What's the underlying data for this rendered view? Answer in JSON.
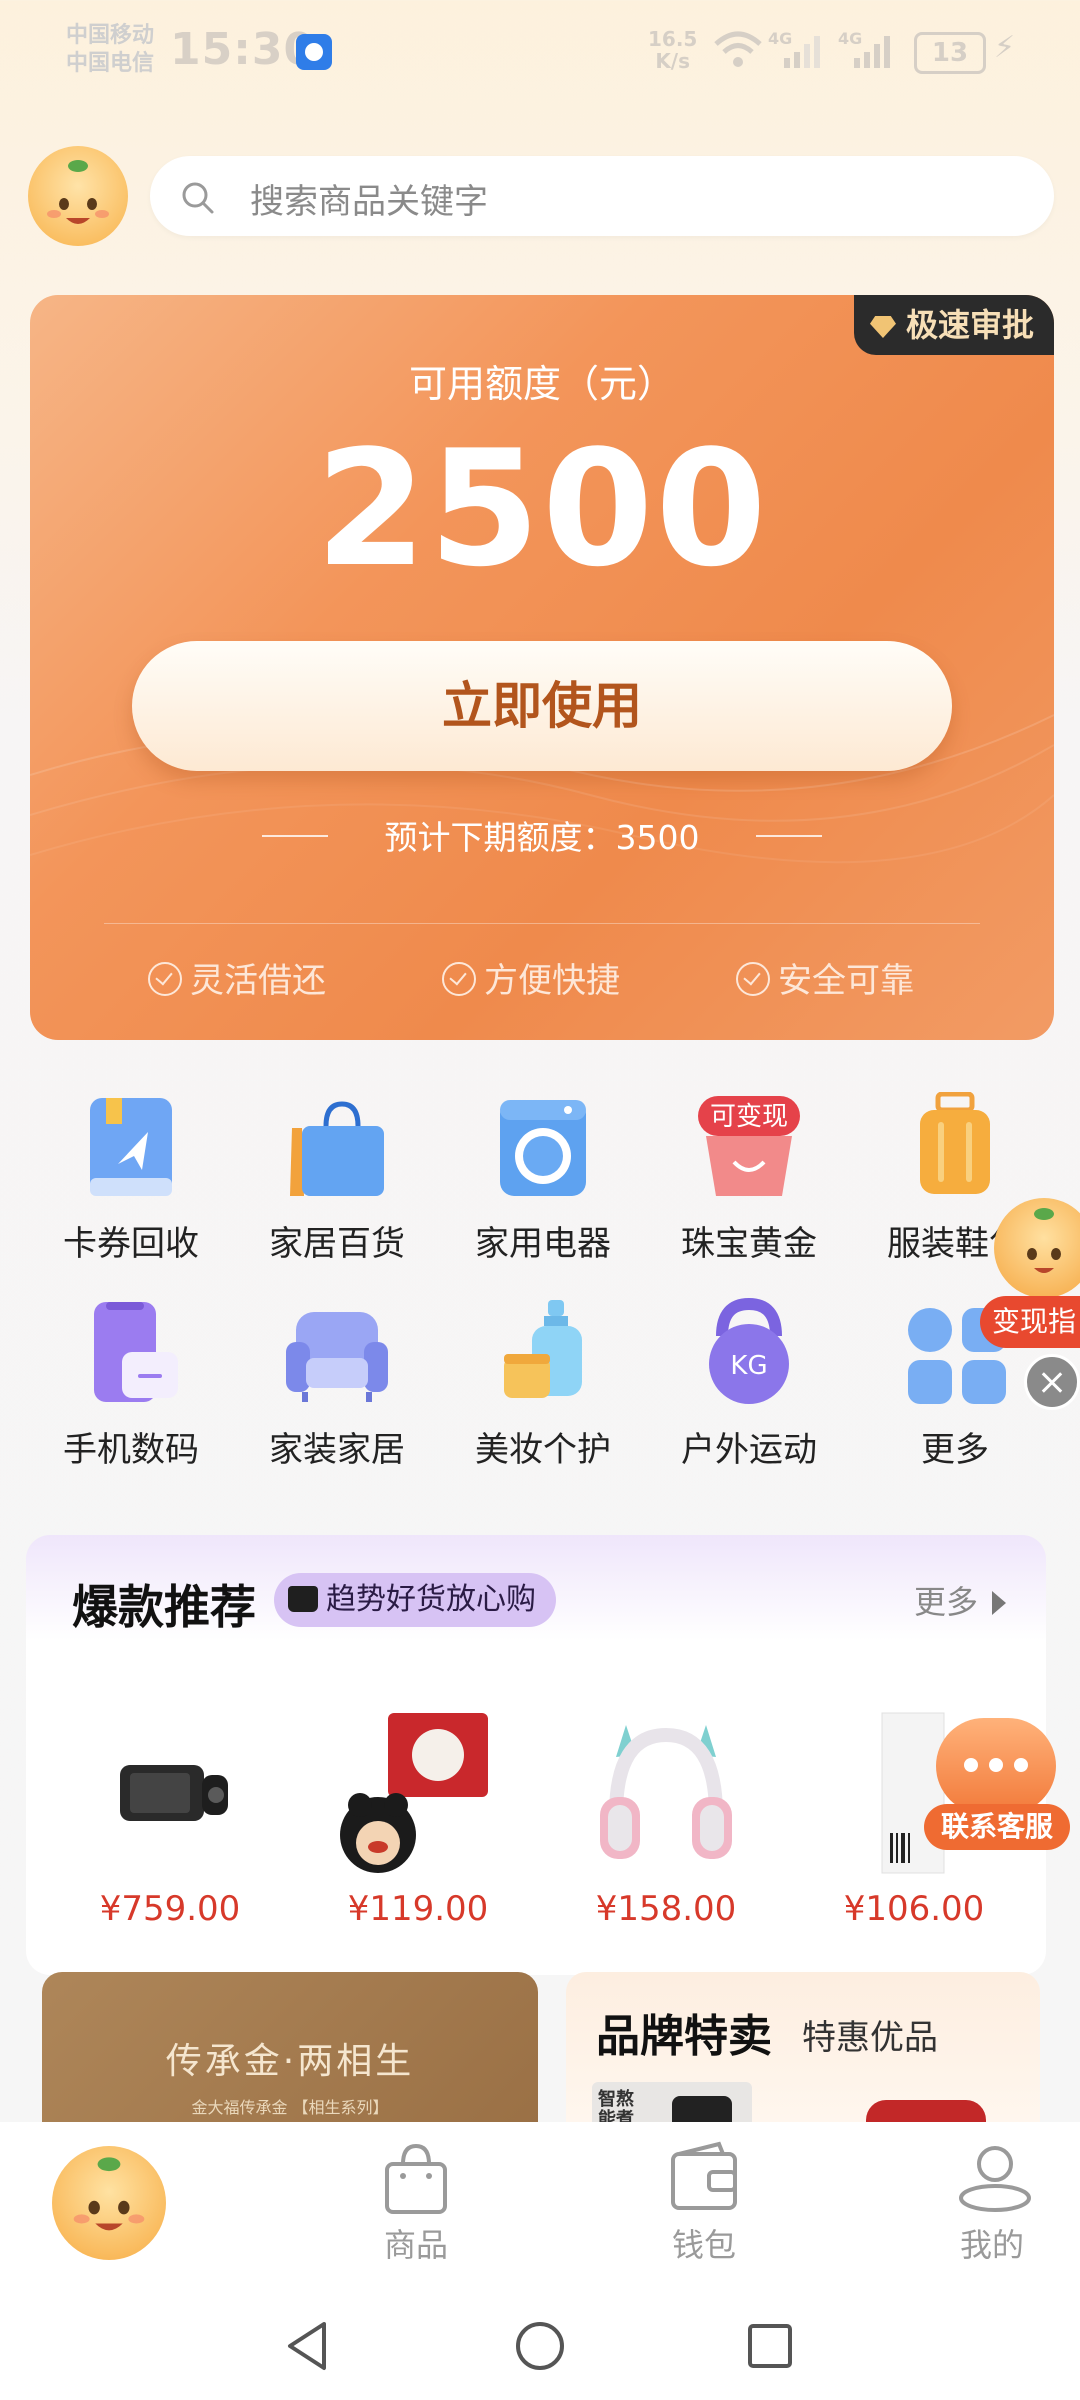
{
  "status_bar": {
    "carrier1": "中国移动",
    "carrier2": "中国电信",
    "time": "15:30",
    "speed_value": "16.5",
    "speed_unit": "K/s",
    "network1": "4G",
    "network2": "4G",
    "battery": "13"
  },
  "search": {
    "placeholder": "搜索商品关键字"
  },
  "credit_card": {
    "badge": "极速审批",
    "label": "可用额度（元）",
    "amount": "2500",
    "button": "立即使用",
    "next_quota": "预计下期额度：3500",
    "features": [
      "灵活借还",
      "方便快捷",
      "安全可靠"
    ]
  },
  "categories": [
    {
      "label": "卡券回收",
      "icon": "coupon-book-icon"
    },
    {
      "label": "家居百货",
      "icon": "shopping-bag-icon"
    },
    {
      "label": "家用电器",
      "icon": "washing-machine-icon"
    },
    {
      "label": "珠宝黄金",
      "icon": "jewelry-basket-icon",
      "badge": "可变现"
    },
    {
      "label": "服装鞋包",
      "icon": "suitcase-icon"
    },
    {
      "label": "手机数码",
      "icon": "phone-icon"
    },
    {
      "label": "家装家居",
      "icon": "sofa-icon"
    },
    {
      "label": "美妆个护",
      "icon": "perfume-icon"
    },
    {
      "label": "户外运动",
      "icon": "kettlebell-icon",
      "icon_text": "KG"
    },
    {
      "label": "更多",
      "icon": "grid-more-icon"
    }
  ],
  "floating_helper": {
    "label": "变现指"
  },
  "recommend": {
    "title": "爆款推荐",
    "tag": "趋势好货放心购",
    "more": "更多",
    "products": [
      {
        "price": "¥759.00",
        "icon": "dashcam-icon"
      },
      {
        "price": "¥119.00",
        "icon": "mickey-speaker-icon"
      },
      {
        "price": "¥158.00",
        "icon": "cat-ear-headphones-icon"
      },
      {
        "price": "¥106.00",
        "icon": "product-box-icon"
      }
    ]
  },
  "customer_service": {
    "label": "联系客服"
  },
  "banners": {
    "gold_title": "传承金·两相生",
    "gold_sub": "金大福传承金 【相生系列】",
    "brand_title": "品牌特卖",
    "brand_sub": "特惠优品",
    "brand_thumb_text": "智熬\n能煮"
  },
  "tabbar": {
    "items": [
      {
        "label": "商品"
      },
      {
        "label": "钱包"
      },
      {
        "label": "我的"
      }
    ]
  },
  "colors": {
    "accent_orange": "#f08a4b",
    "price_red": "#d7392a",
    "badge_dark": "#2b2b2b"
  }
}
